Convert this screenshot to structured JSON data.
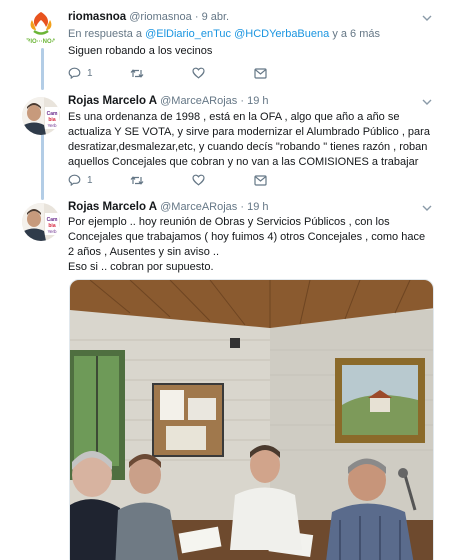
{
  "tweets": [
    {
      "name": "riomasnoa",
      "handle": "@riomasnoa",
      "time": "9 abr.",
      "reply_prefix": "En respuesta a",
      "reply_user_1": "@ElDiario_enTuc",
      "reply_user_2": "@HCDYerbaBuena",
      "reply_suffix": "y a 6 más",
      "text": "Siguen robando a los vecinos",
      "replies": "1",
      "avatar_caption": "RIO MAS NOA"
    },
    {
      "name": "Rojas Marcelo A",
      "handle": "@MarceARojas",
      "time": "19 h",
      "text": "Es una ordenanza de 1998 , está en la OFA , algo que año a año se actualiza Y SE VOTA, y sirve para modernizar el Alumbrado Público , para desratizar,desmalezar,etc, y cuando decís \"robando \" tienes razón , roban aquellos Concejales que cobran y no van a las COMISIONES a trabajar",
      "replies": "1",
      "avatar_caption": "Cambia Yerb"
    },
    {
      "name": "Rojas Marcelo A",
      "handle": "@MarceARojas",
      "time": "19 h",
      "text_lines": [
        "Por ejemplo .. hoy reunión de Obras y Servicios Públicos , con los Concejales que trabajamos ( hoy fuimos 4) otros Concejales , como hace 2 años , Ausentes y sin aviso ..",
        "Eso si .. cobran por supuesto."
      ],
      "avatar_caption": "Cambia Yerb",
      "photo_description": "Men seated at a table reviewing documents in a room with a wooden ceiling, a cork board, a map and a landscape painting"
    }
  ],
  "icons": {
    "reply": "reply-icon",
    "retweet": "retweet-icon",
    "like": "heart-icon",
    "dm": "envelope-icon",
    "more": "chevron-down-icon"
  },
  "colors": {
    "link": "#1b95e0",
    "muted": "#657786",
    "thread_line": "#b3cde6"
  }
}
